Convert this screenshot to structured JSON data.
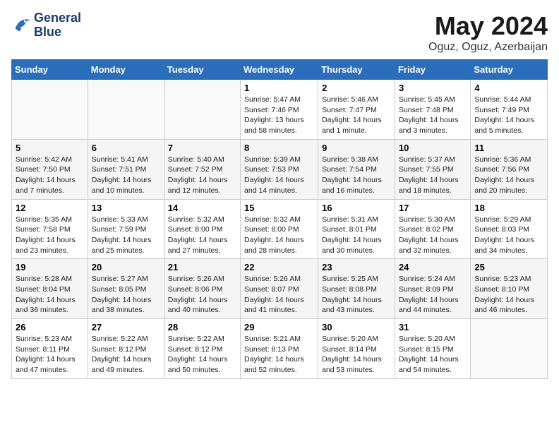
{
  "header": {
    "logo_line1": "General",
    "logo_line2": "Blue",
    "title": "May 2024",
    "subtitle": "Oguz, Oguz, Azerbaijan"
  },
  "days_of_week": [
    "Sunday",
    "Monday",
    "Tuesday",
    "Wednesday",
    "Thursday",
    "Friday",
    "Saturday"
  ],
  "weeks": [
    [
      {
        "day": "",
        "info": ""
      },
      {
        "day": "",
        "info": ""
      },
      {
        "day": "",
        "info": ""
      },
      {
        "day": "1",
        "info": "Sunrise: 5:47 AM\nSunset: 7:46 PM\nDaylight: 13 hours and 58 minutes."
      },
      {
        "day": "2",
        "info": "Sunrise: 5:46 AM\nSunset: 7:47 PM\nDaylight: 14 hours and 1 minute."
      },
      {
        "day": "3",
        "info": "Sunrise: 5:45 AM\nSunset: 7:48 PM\nDaylight: 14 hours and 3 minutes."
      },
      {
        "day": "4",
        "info": "Sunrise: 5:44 AM\nSunset: 7:49 PM\nDaylight: 14 hours and 5 minutes."
      }
    ],
    [
      {
        "day": "5",
        "info": "Sunrise: 5:42 AM\nSunset: 7:50 PM\nDaylight: 14 hours and 7 minutes."
      },
      {
        "day": "6",
        "info": "Sunrise: 5:41 AM\nSunset: 7:51 PM\nDaylight: 14 hours and 10 minutes."
      },
      {
        "day": "7",
        "info": "Sunrise: 5:40 AM\nSunset: 7:52 PM\nDaylight: 14 hours and 12 minutes."
      },
      {
        "day": "8",
        "info": "Sunrise: 5:39 AM\nSunset: 7:53 PM\nDaylight: 14 hours and 14 minutes."
      },
      {
        "day": "9",
        "info": "Sunrise: 5:38 AM\nSunset: 7:54 PM\nDaylight: 14 hours and 16 minutes."
      },
      {
        "day": "10",
        "info": "Sunrise: 5:37 AM\nSunset: 7:55 PM\nDaylight: 14 hours and 18 minutes."
      },
      {
        "day": "11",
        "info": "Sunrise: 5:36 AM\nSunset: 7:56 PM\nDaylight: 14 hours and 20 minutes."
      }
    ],
    [
      {
        "day": "12",
        "info": "Sunrise: 5:35 AM\nSunset: 7:58 PM\nDaylight: 14 hours and 23 minutes."
      },
      {
        "day": "13",
        "info": "Sunrise: 5:33 AM\nSunset: 7:59 PM\nDaylight: 14 hours and 25 minutes."
      },
      {
        "day": "14",
        "info": "Sunrise: 5:32 AM\nSunset: 8:00 PM\nDaylight: 14 hours and 27 minutes."
      },
      {
        "day": "15",
        "info": "Sunrise: 5:32 AM\nSunset: 8:00 PM\nDaylight: 14 hours and 28 minutes."
      },
      {
        "day": "16",
        "info": "Sunrise: 5:31 AM\nSunset: 8:01 PM\nDaylight: 14 hours and 30 minutes."
      },
      {
        "day": "17",
        "info": "Sunrise: 5:30 AM\nSunset: 8:02 PM\nDaylight: 14 hours and 32 minutes."
      },
      {
        "day": "18",
        "info": "Sunrise: 5:29 AM\nSunset: 8:03 PM\nDaylight: 14 hours and 34 minutes."
      }
    ],
    [
      {
        "day": "19",
        "info": "Sunrise: 5:28 AM\nSunset: 8:04 PM\nDaylight: 14 hours and 36 minutes."
      },
      {
        "day": "20",
        "info": "Sunrise: 5:27 AM\nSunset: 8:05 PM\nDaylight: 14 hours and 38 minutes."
      },
      {
        "day": "21",
        "info": "Sunrise: 5:26 AM\nSunset: 8:06 PM\nDaylight: 14 hours and 40 minutes."
      },
      {
        "day": "22",
        "info": "Sunrise: 5:26 AM\nSunset: 8:07 PM\nDaylight: 14 hours and 41 minutes."
      },
      {
        "day": "23",
        "info": "Sunrise: 5:25 AM\nSunset: 8:08 PM\nDaylight: 14 hours and 43 minutes."
      },
      {
        "day": "24",
        "info": "Sunrise: 5:24 AM\nSunset: 8:09 PM\nDaylight: 14 hours and 44 minutes."
      },
      {
        "day": "25",
        "info": "Sunrise: 5:23 AM\nSunset: 8:10 PM\nDaylight: 14 hours and 46 minutes."
      }
    ],
    [
      {
        "day": "26",
        "info": "Sunrise: 5:23 AM\nSunset: 8:11 PM\nDaylight: 14 hours and 47 minutes."
      },
      {
        "day": "27",
        "info": "Sunrise: 5:22 AM\nSunset: 8:12 PM\nDaylight: 14 hours and 49 minutes."
      },
      {
        "day": "28",
        "info": "Sunrise: 5:22 AM\nSunset: 8:12 PM\nDaylight: 14 hours and 50 minutes."
      },
      {
        "day": "29",
        "info": "Sunrise: 5:21 AM\nSunset: 8:13 PM\nDaylight: 14 hours and 52 minutes."
      },
      {
        "day": "30",
        "info": "Sunrise: 5:20 AM\nSunset: 8:14 PM\nDaylight: 14 hours and 53 minutes."
      },
      {
        "day": "31",
        "info": "Sunrise: 5:20 AM\nSunset: 8:15 PM\nDaylight: 14 hours and 54 minutes."
      },
      {
        "day": "",
        "info": ""
      }
    ]
  ]
}
